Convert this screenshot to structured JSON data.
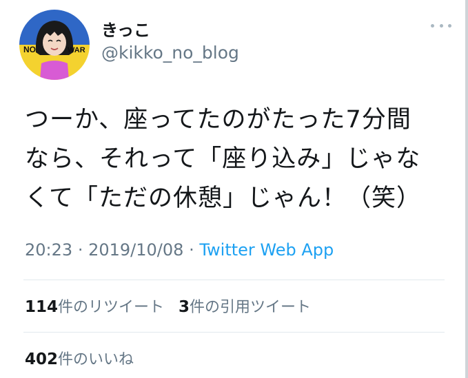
{
  "user": {
    "name": "きっこ",
    "handle": "@kikko_no_blog",
    "avatar": {
      "left_text": "NO",
      "right_text": "WAR",
      "colors": {
        "flag_blue": "#2f67c6",
        "flag_yellow": "#f4d22f",
        "shirt": "#d85bd4",
        "hair": "#1a1a1a",
        "skin": "#f3d7c4"
      }
    }
  },
  "tweet": {
    "lines": [
      "つーか、座ってたのがたった7分間",
      "なら、それって「座り込み」じゃな",
      "くて「ただの休憩」じゃん！（笑）"
    ],
    "time": "20:23",
    "date": "2019/10/08",
    "separator": "·",
    "source": "Twitter Web App"
  },
  "stats": {
    "retweets_count": "114",
    "retweets_label": "件のリツイート",
    "quotes_count": "3",
    "quotes_label": "件の引用ツイート",
    "likes_count": "402",
    "likes_label": "件のいいね"
  },
  "icons": {
    "more": "more-horizontal-icon"
  }
}
